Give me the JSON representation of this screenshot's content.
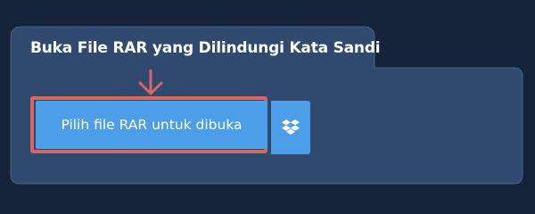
{
  "panel": {
    "title": "Buka File RAR yang Dilindungi Kata Sandi"
  },
  "actions": {
    "choose_file_label": "Pilih file RAR untuk dibuka",
    "dropbox_icon": "dropbox-icon",
    "arrow_icon": "arrow-down-icon"
  },
  "colors": {
    "page_background": "#14233a",
    "panel_background": "#2f4a6e",
    "panel_border": "#4a6486",
    "button_blue": "#4d9ee8",
    "highlight_red": "#d86763"
  }
}
